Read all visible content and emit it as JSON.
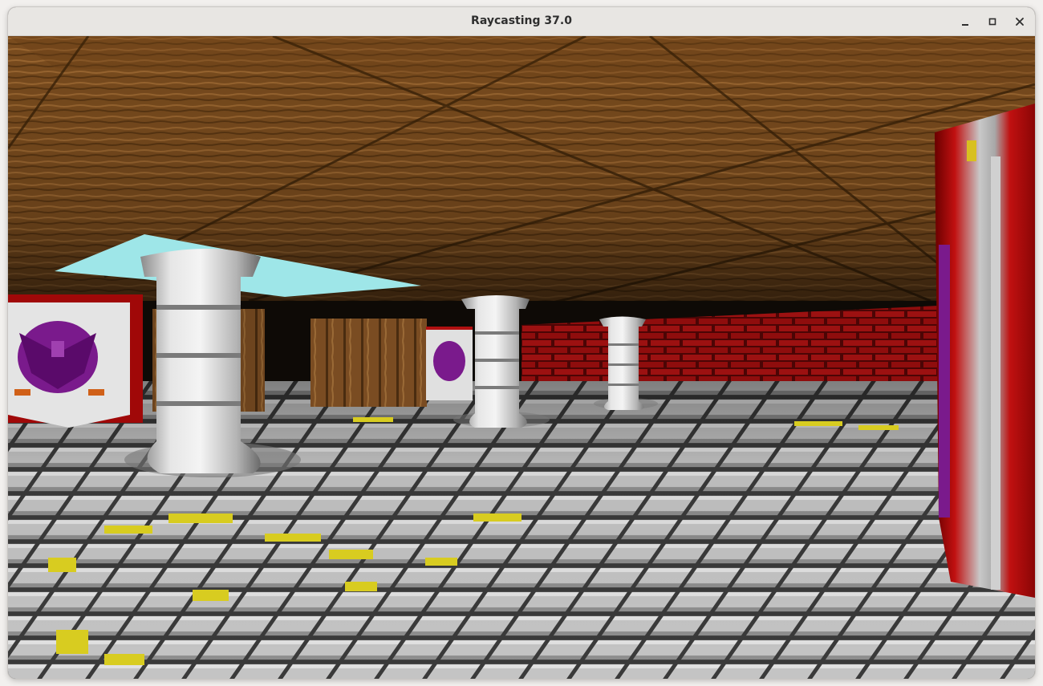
{
  "window": {
    "title": "Raycasting 37.0"
  },
  "titlebar_buttons": [
    {
      "icon": "minimize-icon"
    },
    {
      "icon": "maximize-icon"
    },
    {
      "icon": "close-icon"
    }
  ],
  "scene": {
    "ceiling_texture": "wood-planks",
    "floor_texture": "grey-stone-tiles-with-yellow-moss",
    "wall_texture": "red-brick",
    "banner_texture": "purple-eagle-banner",
    "column_texture": "white-stone-column",
    "crate_texture": "wood-crate",
    "sky_color": "#9ee6e8",
    "colors": {
      "wood_light": "#8a5a26",
      "wood_dark": "#4a2c0e",
      "stone": "#b8b8b8",
      "stone_dark": "#3a3a3a",
      "moss": "#d8cc20",
      "brick": "#b01010",
      "brick_dark": "#5a0606",
      "banner_purple": "#7a1a8c",
      "banner_red": "#c01818"
    }
  }
}
